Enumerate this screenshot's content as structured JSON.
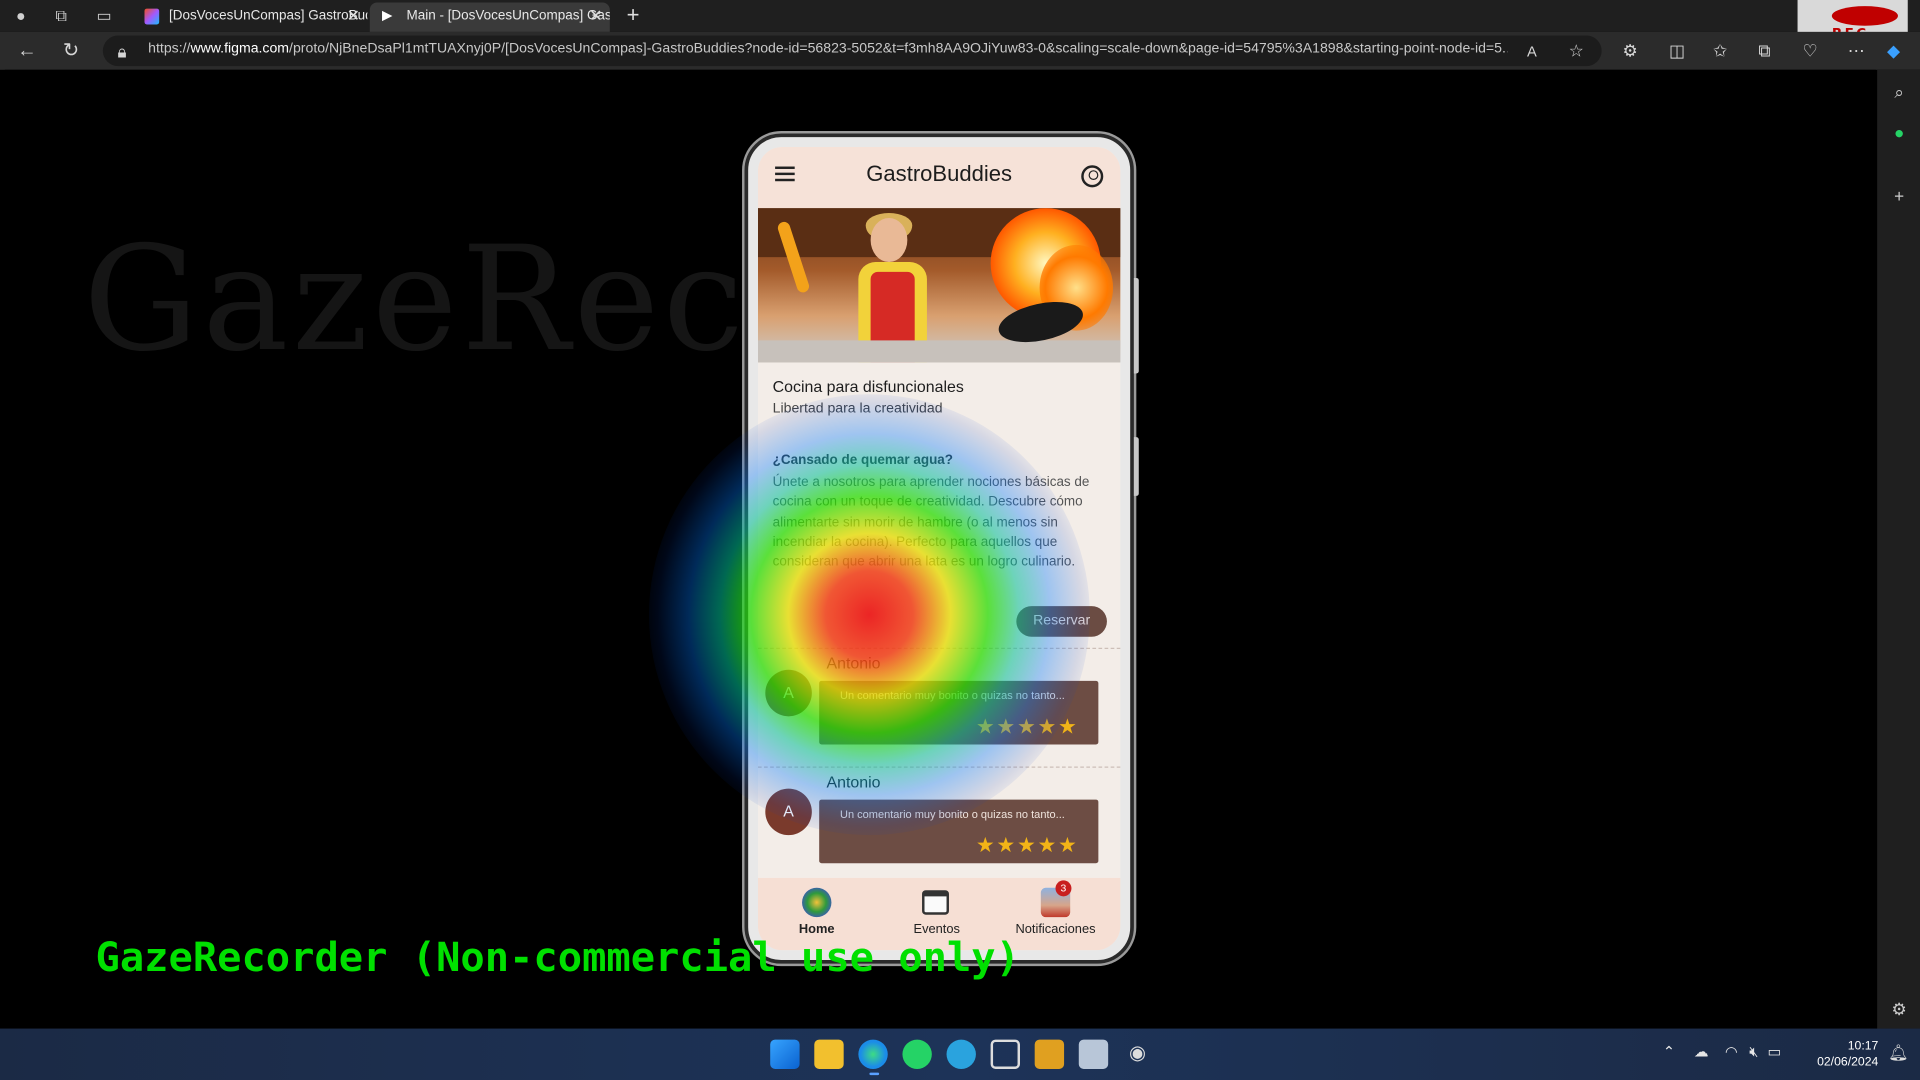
{
  "browser": {
    "tabs": [
      {
        "title": "[DosVocesUnCompas] GastroBuddies",
        "active": false
      },
      {
        "title": "Main - [DosVocesUnCompas] GastroBuddies",
        "active": true
      }
    ],
    "url_prefix": "https://",
    "url_domain": "www.figma.com",
    "url_rest": "/proto/NjBneDsaPl1mtTUAXnyj0P/[DosVocesUnCompas]-GastroBuddies?node-id=56823-5052&t=f3mh8AA9OJiYuw83-0&scaling=scale-down&page-id=54795%3A1898&starting-point-node-id=5...",
    "rec_label": "REC"
  },
  "overlay": {
    "ghost_text": "GazeRec",
    "watermark": "GazeRecorder (Non-commercial use only)"
  },
  "app": {
    "title": "GastroBuddies",
    "card": {
      "title": "Cocina para disfuncionales",
      "subtitle": "Libertad para la creatividad",
      "question": "¿Cansado de quemar agua?",
      "description": "Únete a nosotros para aprender nociones básicas de cocina con un toque de creatividad. Descubre cómo alimentarte sin  morir de hambre (o al menos sin incendiar la cocina). Perfecto para aquellos que consideran que abrir una lata es un logro culinario.",
      "button": "Reservar"
    },
    "reviews": [
      {
        "initial": "A",
        "name": "Antonio",
        "comment": "Un comentario muy bonito o quizas no tanto...",
        "rating": 5
      },
      {
        "initial": "A",
        "name": "Antonio",
        "comment": "Un comentario muy bonito o quizas no tanto...",
        "rating": 5
      }
    ],
    "bottom_nav": [
      {
        "label": "Home",
        "icon": "home-icon",
        "active": true
      },
      {
        "label": "Eventos",
        "icon": "calendar-clock-icon",
        "active": false
      },
      {
        "label": "Notificaciones",
        "icon": "notifications-avatar-icon",
        "active": false,
        "badge": "3"
      }
    ]
  },
  "taskbar": {
    "time": "10:17",
    "date": "02/06/2024"
  },
  "colors": {
    "appbar": "#f6e2d8",
    "button": "#6b4c43",
    "star": "#f2b417",
    "watermark": "#00e000"
  }
}
